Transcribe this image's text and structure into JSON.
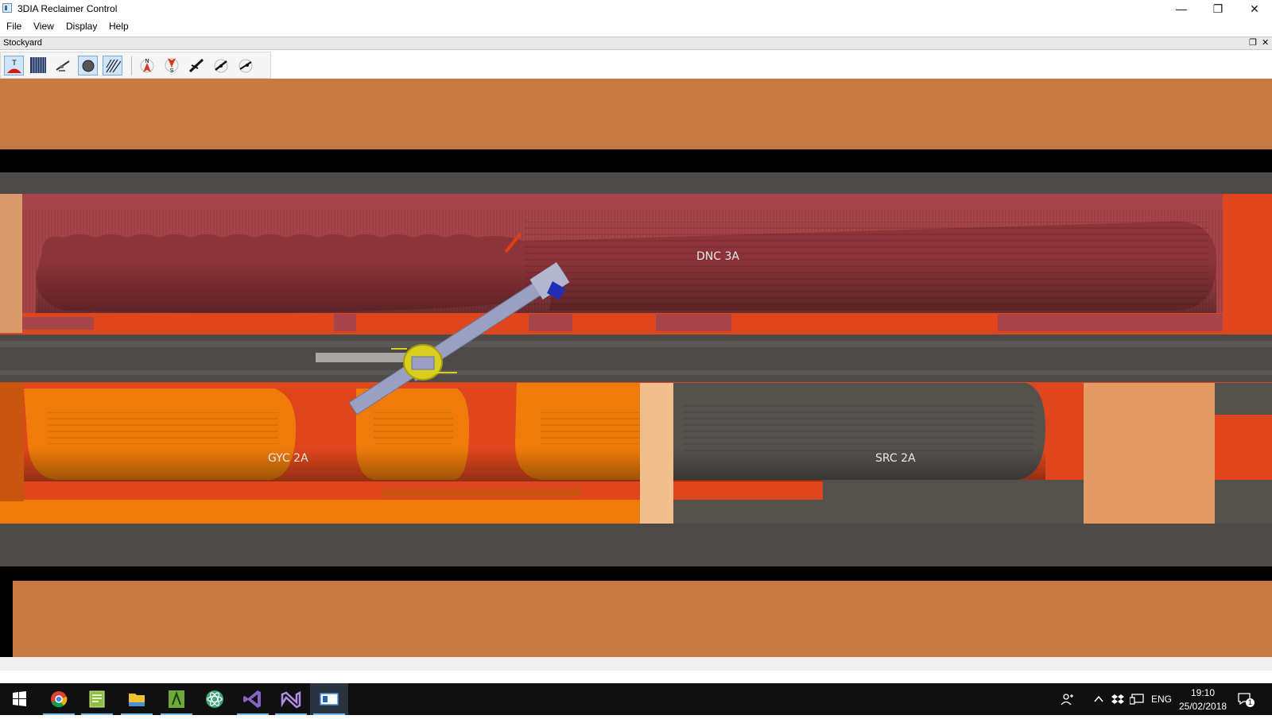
{
  "window": {
    "title": "3DIA Reclaimer Control",
    "minimize_glyph": "—",
    "restore_glyph": "❐",
    "close_glyph": "✕"
  },
  "menu": {
    "items": [
      {
        "label": "File"
      },
      {
        "label": "View"
      },
      {
        "label": "Display"
      },
      {
        "label": "Help"
      }
    ]
  },
  "panel": {
    "title": "Stockyard",
    "float_glyph": "❐",
    "close_glyph": "✕"
  },
  "toolbar": {
    "tools": [
      {
        "icon": "top-view-icon",
        "text": "T",
        "checked": true
      },
      {
        "icon": "stripes-icon",
        "checked": false
      },
      {
        "icon": "reclaimer-side-icon",
        "checked": false
      },
      {
        "icon": "circle-icon",
        "checked": true
      },
      {
        "icon": "hatch-icon",
        "checked": true
      },
      {
        "icon": "north-arrow-icon",
        "text": "N",
        "checked": false
      },
      {
        "icon": "south-arrow-icon",
        "text": "S",
        "checked": false
      },
      {
        "icon": "boom-icon",
        "checked": false
      },
      {
        "icon": "boom-pivot-icon",
        "checked": false
      },
      {
        "icon": "boom-pivot-alt-icon",
        "checked": false
      }
    ]
  },
  "stockyard": {
    "piles": [
      {
        "label": "DNC 3A"
      },
      {
        "label": "GYC 2A"
      },
      {
        "label": "SRC 2A"
      }
    ],
    "colors": {
      "ground": "#c87941",
      "black": "#000000",
      "rail_gray": "#4d4a47",
      "dnc_pile": "#a8454a",
      "red_floor": "#e0461d",
      "gyc_pile": "#ef7c0a",
      "src_pile": "#55524e",
      "boom": "#9aa0c2",
      "turntable": "#d8cf1f"
    }
  },
  "taskbar": {
    "apps": [
      {
        "icon": "start-icon",
        "active": false
      },
      {
        "icon": "chrome-icon",
        "active": true
      },
      {
        "icon": "notepad-icon",
        "active": true
      },
      {
        "icon": "file-explorer-icon",
        "active": true
      },
      {
        "icon": "spreadsheet-icon",
        "active": true
      },
      {
        "icon": "atom-icon",
        "active": false
      },
      {
        "icon": "visual-studio-code-icon",
        "active": true
      },
      {
        "icon": "visual-studio-icon",
        "active": true
      },
      {
        "icon": "reclaimer-app-icon",
        "active": true
      }
    ],
    "tray": {
      "language": "ENG",
      "time": "19:10",
      "date": "25/02/2018",
      "notification_count": "1"
    }
  }
}
